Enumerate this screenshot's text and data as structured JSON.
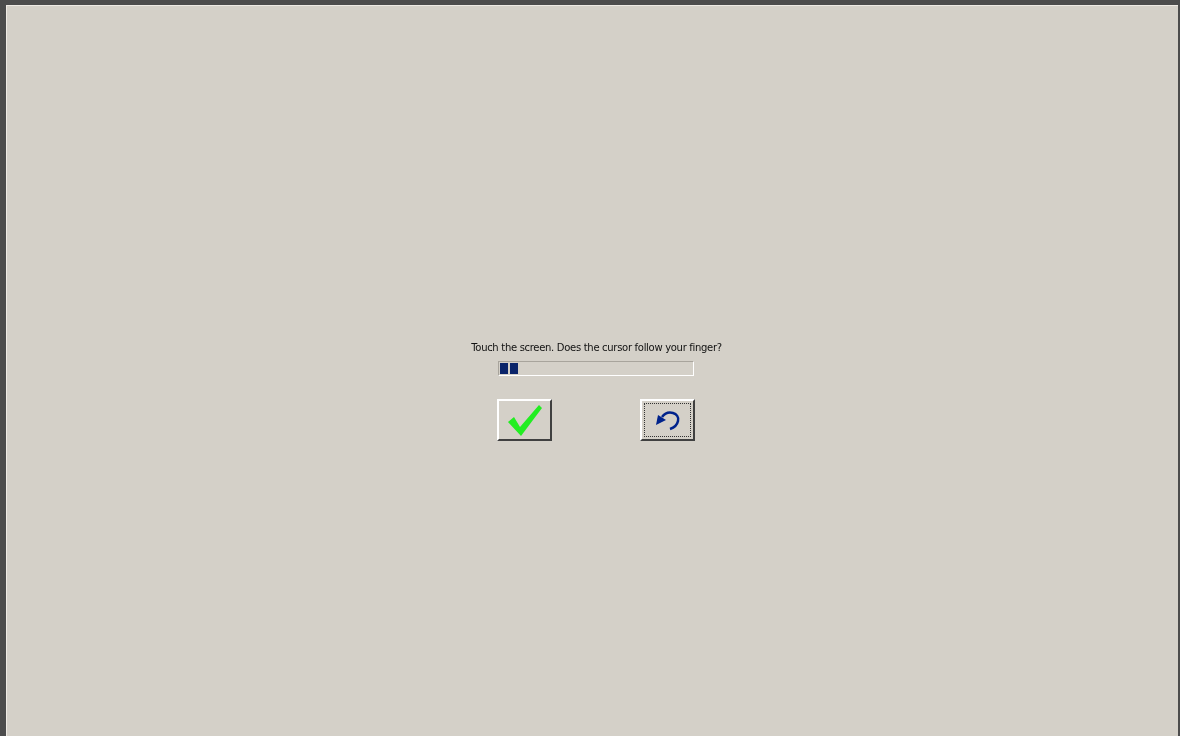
{
  "prompt": "Touch the screen. Does the cursor follow your finger?",
  "progress": {
    "level": 0.1
  },
  "buttons": [
    {
      "kind": "accept",
      "focused": false
    },
    {
      "kind": "undo",
      "focused": true
    }
  ]
}
